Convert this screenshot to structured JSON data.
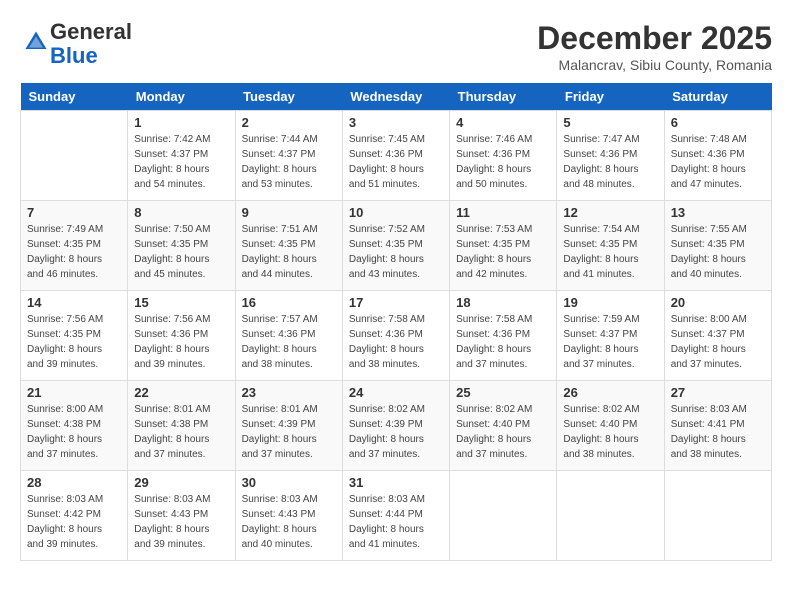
{
  "header": {
    "logo_general": "General",
    "logo_blue": "Blue",
    "month_title": "December 2025",
    "location": "Malancrav, Sibiu County, Romania"
  },
  "days_of_week": [
    "Sunday",
    "Monday",
    "Tuesday",
    "Wednesday",
    "Thursday",
    "Friday",
    "Saturday"
  ],
  "weeks": [
    [
      {
        "day": "",
        "info": ""
      },
      {
        "day": "1",
        "info": "Sunrise: 7:42 AM\nSunset: 4:37 PM\nDaylight: 8 hours\nand 54 minutes."
      },
      {
        "day": "2",
        "info": "Sunrise: 7:44 AM\nSunset: 4:37 PM\nDaylight: 8 hours\nand 53 minutes."
      },
      {
        "day": "3",
        "info": "Sunrise: 7:45 AM\nSunset: 4:36 PM\nDaylight: 8 hours\nand 51 minutes."
      },
      {
        "day": "4",
        "info": "Sunrise: 7:46 AM\nSunset: 4:36 PM\nDaylight: 8 hours\nand 50 minutes."
      },
      {
        "day": "5",
        "info": "Sunrise: 7:47 AM\nSunset: 4:36 PM\nDaylight: 8 hours\nand 48 minutes."
      },
      {
        "day": "6",
        "info": "Sunrise: 7:48 AM\nSunset: 4:36 PM\nDaylight: 8 hours\nand 47 minutes."
      }
    ],
    [
      {
        "day": "7",
        "info": "Sunrise: 7:49 AM\nSunset: 4:35 PM\nDaylight: 8 hours\nand 46 minutes."
      },
      {
        "day": "8",
        "info": "Sunrise: 7:50 AM\nSunset: 4:35 PM\nDaylight: 8 hours\nand 45 minutes."
      },
      {
        "day": "9",
        "info": "Sunrise: 7:51 AM\nSunset: 4:35 PM\nDaylight: 8 hours\nand 44 minutes."
      },
      {
        "day": "10",
        "info": "Sunrise: 7:52 AM\nSunset: 4:35 PM\nDaylight: 8 hours\nand 43 minutes."
      },
      {
        "day": "11",
        "info": "Sunrise: 7:53 AM\nSunset: 4:35 PM\nDaylight: 8 hours\nand 42 minutes."
      },
      {
        "day": "12",
        "info": "Sunrise: 7:54 AM\nSunset: 4:35 PM\nDaylight: 8 hours\nand 41 minutes."
      },
      {
        "day": "13",
        "info": "Sunrise: 7:55 AM\nSunset: 4:35 PM\nDaylight: 8 hours\nand 40 minutes."
      }
    ],
    [
      {
        "day": "14",
        "info": "Sunrise: 7:56 AM\nSunset: 4:35 PM\nDaylight: 8 hours\nand 39 minutes."
      },
      {
        "day": "15",
        "info": "Sunrise: 7:56 AM\nSunset: 4:36 PM\nDaylight: 8 hours\nand 39 minutes."
      },
      {
        "day": "16",
        "info": "Sunrise: 7:57 AM\nSunset: 4:36 PM\nDaylight: 8 hours\nand 38 minutes."
      },
      {
        "day": "17",
        "info": "Sunrise: 7:58 AM\nSunset: 4:36 PM\nDaylight: 8 hours\nand 38 minutes."
      },
      {
        "day": "18",
        "info": "Sunrise: 7:58 AM\nSunset: 4:36 PM\nDaylight: 8 hours\nand 37 minutes."
      },
      {
        "day": "19",
        "info": "Sunrise: 7:59 AM\nSunset: 4:37 PM\nDaylight: 8 hours\nand 37 minutes."
      },
      {
        "day": "20",
        "info": "Sunrise: 8:00 AM\nSunset: 4:37 PM\nDaylight: 8 hours\nand 37 minutes."
      }
    ],
    [
      {
        "day": "21",
        "info": "Sunrise: 8:00 AM\nSunset: 4:38 PM\nDaylight: 8 hours\nand 37 minutes."
      },
      {
        "day": "22",
        "info": "Sunrise: 8:01 AM\nSunset: 4:38 PM\nDaylight: 8 hours\nand 37 minutes."
      },
      {
        "day": "23",
        "info": "Sunrise: 8:01 AM\nSunset: 4:39 PM\nDaylight: 8 hours\nand 37 minutes."
      },
      {
        "day": "24",
        "info": "Sunrise: 8:02 AM\nSunset: 4:39 PM\nDaylight: 8 hours\nand 37 minutes."
      },
      {
        "day": "25",
        "info": "Sunrise: 8:02 AM\nSunset: 4:40 PM\nDaylight: 8 hours\nand 37 minutes."
      },
      {
        "day": "26",
        "info": "Sunrise: 8:02 AM\nSunset: 4:40 PM\nDaylight: 8 hours\nand 38 minutes."
      },
      {
        "day": "27",
        "info": "Sunrise: 8:03 AM\nSunset: 4:41 PM\nDaylight: 8 hours\nand 38 minutes."
      }
    ],
    [
      {
        "day": "28",
        "info": "Sunrise: 8:03 AM\nSunset: 4:42 PM\nDaylight: 8 hours\nand 39 minutes."
      },
      {
        "day": "29",
        "info": "Sunrise: 8:03 AM\nSunset: 4:43 PM\nDaylight: 8 hours\nand 39 minutes."
      },
      {
        "day": "30",
        "info": "Sunrise: 8:03 AM\nSunset: 4:43 PM\nDaylight: 8 hours\nand 40 minutes."
      },
      {
        "day": "31",
        "info": "Sunrise: 8:03 AM\nSunset: 4:44 PM\nDaylight: 8 hours\nand 41 minutes."
      },
      {
        "day": "",
        "info": ""
      },
      {
        "day": "",
        "info": ""
      },
      {
        "day": "",
        "info": ""
      }
    ]
  ]
}
